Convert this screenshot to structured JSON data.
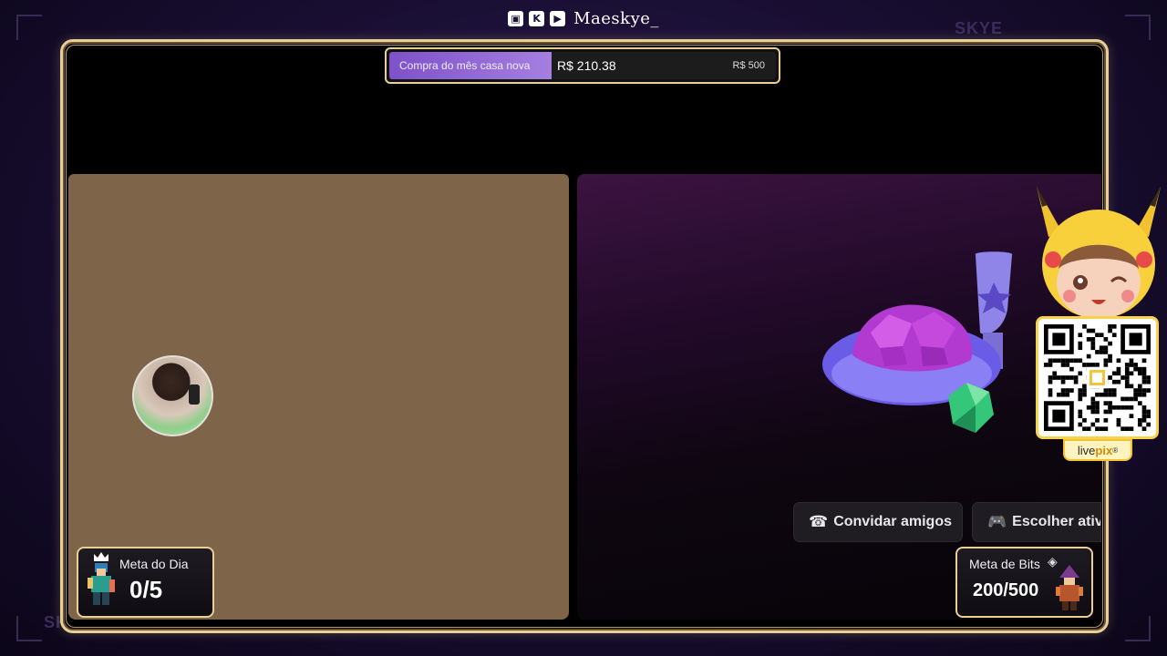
{
  "header": {
    "channel_name": "Maeskye_",
    "icons": [
      "twitch-icon",
      "kick-icon",
      "youtube-icon"
    ]
  },
  "watermarks": {
    "top": "SKYE",
    "bottom": "SKYE"
  },
  "goal_bar": {
    "title": "Compra do mês casa nova",
    "current": "R$ 210.38",
    "target": "R$ 500",
    "progress_fraction": 0.42
  },
  "game_panel": {
    "buttons": [
      {
        "label": "Convidar amigos",
        "icon": "invite-user-icon"
      },
      {
        "label": "Escolher ativ",
        "icon": "gamepad-icon"
      }
    ]
  },
  "meta_day": {
    "label": "Meta do Dia",
    "value": "0/5"
  },
  "meta_bits": {
    "label": "Meta de Bits",
    "value": "200/500"
  },
  "livepix": {
    "brand_prefix": "live",
    "brand_suffix": "pix",
    "mark": "®"
  },
  "colors": {
    "frame_gold": "#e9cf95",
    "goal_fill": "#8a5fd4",
    "cam_bg": "#7e6448",
    "livepix_yellow": "#f1c232"
  }
}
